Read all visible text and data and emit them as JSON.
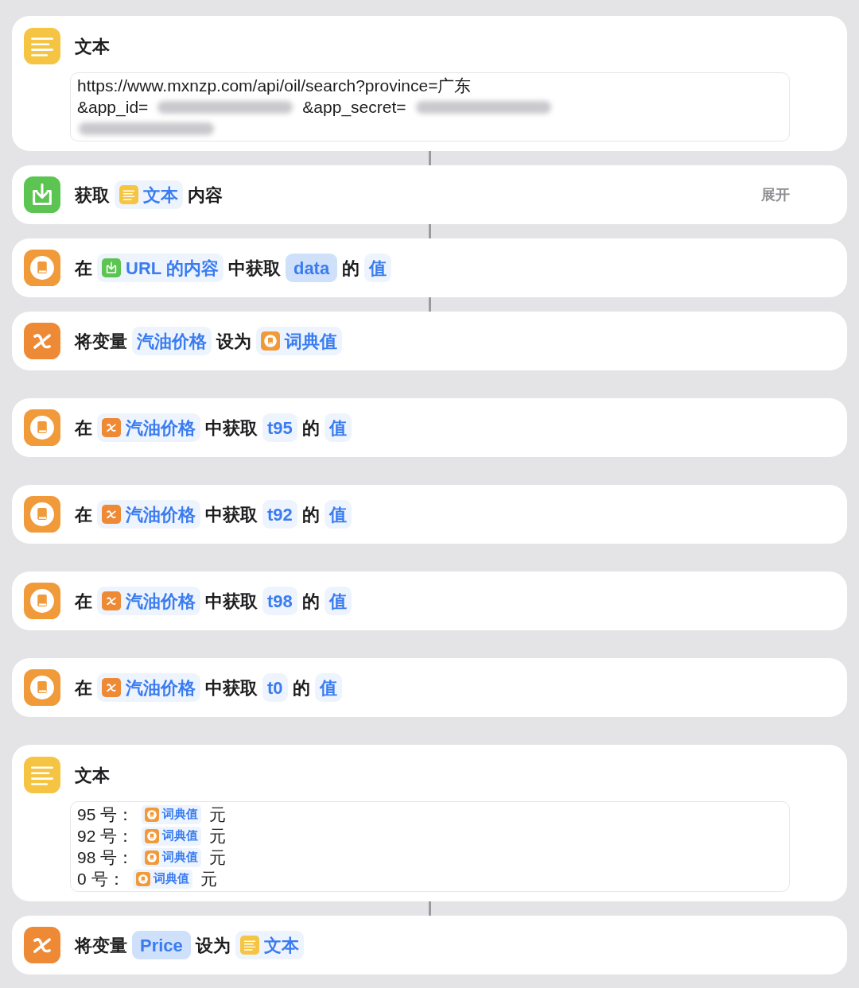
{
  "actions": [
    {
      "kind": "text",
      "title": "文本",
      "connected_to_next": true,
      "lines": [
        [
          {
            "kind": "plain",
            "text": "https://www.mxnzp.com/api/oil/search?province=广东"
          }
        ],
        [
          {
            "kind": "plain",
            "text": "&app_id="
          },
          {
            "kind": "redacted"
          },
          {
            "kind": "plain",
            "text": "&app_secret="
          },
          {
            "kind": "redacted"
          }
        ],
        [
          {
            "kind": "redacted"
          }
        ]
      ]
    },
    {
      "kind": "get_contents",
      "connected_to_next": true,
      "link": "展开",
      "parts": [
        {
          "kind": "word",
          "text": "获取"
        },
        {
          "kind": "text_variable",
          "text": "文本"
        },
        {
          "kind": "word",
          "text": "内容"
        }
      ]
    },
    {
      "kind": "dict_value",
      "connected_to_next": true,
      "parts": [
        {
          "kind": "word",
          "text": "在"
        },
        {
          "kind": "contents_variable",
          "text": "URL 的内容"
        },
        {
          "kind": "word",
          "text": "中获取"
        },
        {
          "kind": "input",
          "text": "data"
        },
        {
          "kind": "word",
          "text": "的"
        },
        {
          "kind": "value",
          "text": "值"
        }
      ]
    },
    {
      "kind": "set_variable",
      "connected_to_next": false,
      "parts": [
        {
          "kind": "word",
          "text": "将变量"
        },
        {
          "kind": "value",
          "text": "汽油价格"
        },
        {
          "kind": "word",
          "text": "设为"
        },
        {
          "kind": "dict_variable",
          "text": "词典值"
        }
      ]
    },
    {
      "kind": "dict_value",
      "connected_to_next": false,
      "parts": [
        {
          "kind": "word",
          "text": "在"
        },
        {
          "kind": "named_variable",
          "text": "汽油价格"
        },
        {
          "kind": "word",
          "text": "中获取"
        },
        {
          "kind": "value",
          "text": "t95"
        },
        {
          "kind": "word",
          "text": "的"
        },
        {
          "kind": "value",
          "text": "值"
        }
      ]
    },
    {
      "kind": "dict_value",
      "connected_to_next": false,
      "parts": [
        {
          "kind": "word",
          "text": "在"
        },
        {
          "kind": "named_variable",
          "text": "汽油价格"
        },
        {
          "kind": "word",
          "text": "中获取"
        },
        {
          "kind": "value",
          "text": "t92"
        },
        {
          "kind": "word",
          "text": "的"
        },
        {
          "kind": "value",
          "text": "值"
        }
      ]
    },
    {
      "kind": "dict_value",
      "connected_to_next": false,
      "parts": [
        {
          "kind": "word",
          "text": "在"
        },
        {
          "kind": "named_variable",
          "text": "汽油价格"
        },
        {
          "kind": "word",
          "text": "中获取"
        },
        {
          "kind": "value",
          "text": "t98"
        },
        {
          "kind": "word",
          "text": "的"
        },
        {
          "kind": "value",
          "text": "值"
        }
      ]
    },
    {
      "kind": "dict_value",
      "connected_to_next": false,
      "parts": [
        {
          "kind": "word",
          "text": "在"
        },
        {
          "kind": "named_variable",
          "text": "汽油价格"
        },
        {
          "kind": "word",
          "text": "中获取"
        },
        {
          "kind": "value",
          "text": "t0"
        },
        {
          "kind": "word",
          "text": "的"
        },
        {
          "kind": "value",
          "text": "值"
        }
      ]
    },
    {
      "kind": "text",
      "title": "文本",
      "connected_to_next": true,
      "lines": [
        [
          {
            "kind": "plain",
            "text": "95 号："
          },
          {
            "kind": "dict_variable",
            "text": "词典值"
          },
          {
            "kind": "plain",
            "text": "元"
          }
        ],
        [
          {
            "kind": "plain",
            "text": "92 号："
          },
          {
            "kind": "dict_variable",
            "text": "词典值"
          },
          {
            "kind": "plain",
            "text": "元"
          }
        ],
        [
          {
            "kind": "plain",
            "text": "98 号："
          },
          {
            "kind": "dict_variable",
            "text": "词典值"
          },
          {
            "kind": "plain",
            "text": "元"
          }
        ],
        [
          {
            "kind": "plain",
            "text": "0 号："
          },
          {
            "kind": "dict_variable",
            "text": "词典值"
          },
          {
            "kind": "plain",
            "text": "元"
          }
        ]
      ]
    },
    {
      "kind": "set_variable",
      "parts": [
        {
          "kind": "word",
          "text": "将变量"
        },
        {
          "kind": "input",
          "text": "Price"
        },
        {
          "kind": "word",
          "text": "设为"
        },
        {
          "kind": "text_variable",
          "text": "文本"
        }
      ]
    }
  ]
}
